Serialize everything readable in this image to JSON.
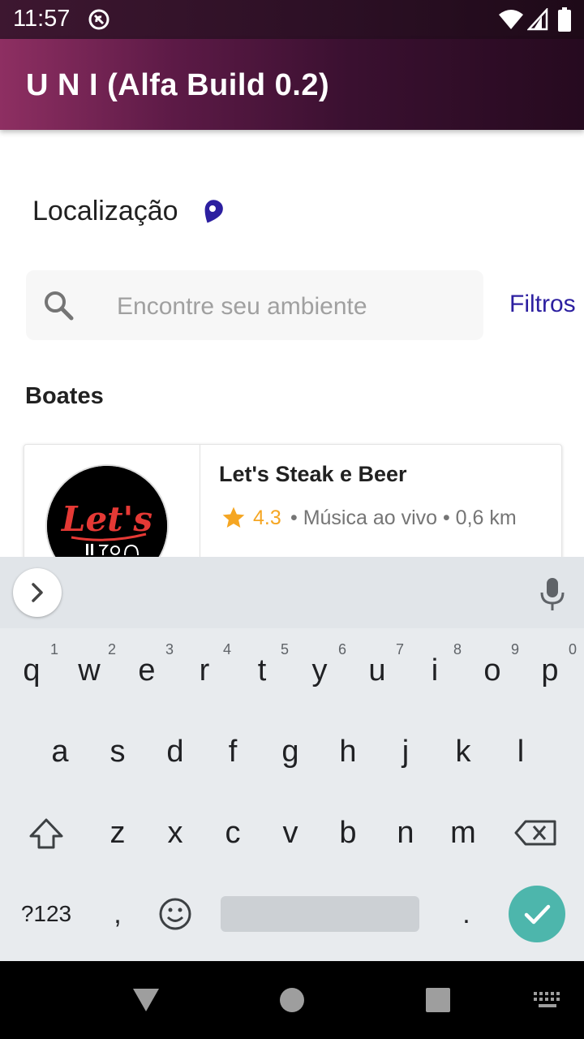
{
  "status_bar": {
    "time": "11:57"
  },
  "app_bar": {
    "title": "U N I (Alfa Build 0.2)"
  },
  "location": {
    "label": "Localização",
    "icon": "location-pin-icon"
  },
  "search": {
    "placeholder": "Encontre seu ambiente",
    "value": "",
    "filters_label": "Filtros"
  },
  "section": {
    "title": "Boates"
  },
  "venues": [
    {
      "name": "Let's Steak e Beer",
      "rating": "4.3",
      "details": "• Música ao vivo • 0,6 km",
      "logo_text": "Let's"
    }
  ],
  "keyboard": {
    "row1": [
      {
        "key": "q",
        "hint": "1"
      },
      {
        "key": "w",
        "hint": "2"
      },
      {
        "key": "e",
        "hint": "3"
      },
      {
        "key": "r",
        "hint": "4"
      },
      {
        "key": "t",
        "hint": "5"
      },
      {
        "key": "y",
        "hint": "6"
      },
      {
        "key": "u",
        "hint": "7"
      },
      {
        "key": "i",
        "hint": "8"
      },
      {
        "key": "o",
        "hint": "9"
      },
      {
        "key": "p",
        "hint": "0"
      }
    ],
    "row2": [
      "a",
      "s",
      "d",
      "f",
      "g",
      "h",
      "j",
      "k",
      "l"
    ],
    "row3": [
      "z",
      "x",
      "c",
      "v",
      "b",
      "n",
      "m"
    ],
    "symbols_label": "?123",
    "comma_label": ",",
    "period_label": "."
  },
  "colors": {
    "accent": "#2c1fa0",
    "star": "#f5a623",
    "enter": "#4db6ac"
  }
}
